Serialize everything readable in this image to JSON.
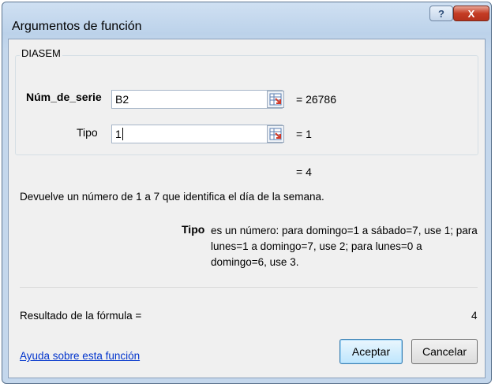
{
  "window": {
    "title": "Argumentos de función",
    "help_glyph": "?",
    "close_glyph": "X"
  },
  "function": {
    "name": "DIASEM",
    "args": [
      {
        "label": "Núm_de_serie",
        "value": "B2",
        "result": "= 26786"
      },
      {
        "label": "Tipo",
        "value": "1",
        "result": "= 1"
      }
    ],
    "overall_result": "= 4",
    "description": "Devuelve un número de 1 a 7 que identifica el día de la semana.",
    "param_name": "Tipo",
    "param_description": "es un número: para domingo=1 a sábado=7, use 1; para lunes=1 a domingo=7, use 2; para lunes=0 a domingo=6, use 3."
  },
  "footer": {
    "result_label": "Resultado de la fórmula =",
    "result_value": "4",
    "help_link": "Ayuda sobre esta función",
    "ok_label": "Aceptar",
    "cancel_label": "Cancelar"
  }
}
